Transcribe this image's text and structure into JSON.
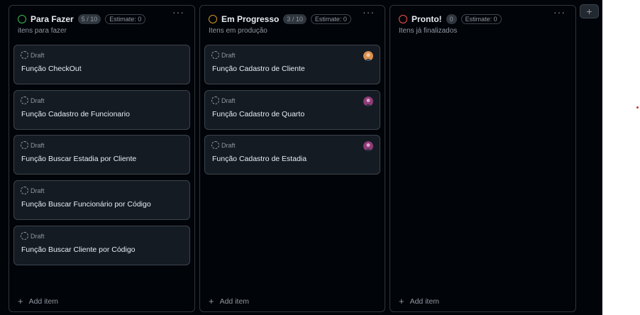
{
  "columns": [
    {
      "title": "Para Fazer",
      "count": "5 / 10",
      "estimate": "Estimate: 0",
      "description": "itens para fazer",
      "status_color": "#3fb950",
      "cards": [
        {
          "status": "Draft",
          "title": "Função CheckOut"
        },
        {
          "status": "Draft",
          "title": "Função Cadastro de Funcionario"
        },
        {
          "status": "Draft",
          "title": "Função Buscar Estadia por Cliente"
        },
        {
          "status": "Draft",
          "title": "Função Buscar Funcionário por Código"
        },
        {
          "status": "Draft",
          "title": "Função Buscar Cliente por Código"
        }
      ],
      "add_label": "Add item"
    },
    {
      "title": "Em Progresso",
      "count": "3 / 10",
      "estimate": "Estimate: 0",
      "description": "Itens em produção",
      "status_color": "#d29922",
      "cards": [
        {
          "status": "Draft",
          "title": "Função Cadastro de Cliente"
        },
        {
          "status": "Draft",
          "title": "Função Cadastro de Quarto"
        },
        {
          "status": "Draft",
          "title": "Função Cadastro de Estadia"
        }
      ],
      "add_label": "Add item"
    },
    {
      "title": "Pronto!",
      "count": "0",
      "estimate": "Estimate: 0",
      "description": "Itens já finalizados",
      "status_color": "#f85149",
      "cards": [],
      "add_label": "Add item"
    }
  ],
  "icons": {
    "menu": "kebab-horizontal-icon",
    "add": "plus-icon",
    "draft": "draft-circle-icon"
  },
  "add_column_label": "+",
  "menu_glyph": "···",
  "add_glyph": "+"
}
